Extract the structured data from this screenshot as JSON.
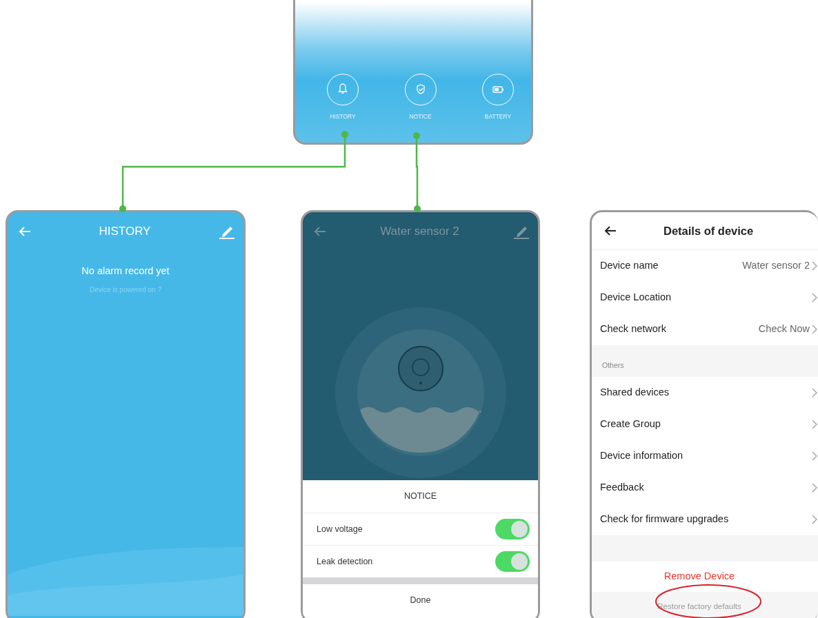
{
  "top_phone": {
    "items": [
      {
        "label": "HISTORY",
        "kind": "bell"
      },
      {
        "label": "NOTICE",
        "kind": "shield"
      },
      {
        "label": "BATTERY",
        "kind": "battery"
      }
    ]
  },
  "history_screen": {
    "title": "HISTORY",
    "message": "No alarm record yet",
    "hint": "Device is powered on ?"
  },
  "notice_screen": {
    "title": "Water sensor 2",
    "sheet_title": "NOTICE",
    "toggles": [
      {
        "label": "Low voltage",
        "on": true
      },
      {
        "label": "Leak detection",
        "on": true
      }
    ],
    "done": "Done"
  },
  "details_screen": {
    "title": "Details of device",
    "rows": [
      {
        "label": "Device name",
        "value": "Water sensor 2"
      },
      {
        "label": "Device Location"
      },
      {
        "label": "Check network",
        "value": "Check Now"
      }
    ],
    "section": "Others",
    "more_rows": [
      {
        "label": "Shared devices"
      },
      {
        "label": "Create Group"
      },
      {
        "label": "Device information"
      },
      {
        "label": "Feedback"
      },
      {
        "label": "Check for firmware upgrades"
      }
    ],
    "remove": "Remove Device",
    "restore": "Restore factory defaults"
  }
}
